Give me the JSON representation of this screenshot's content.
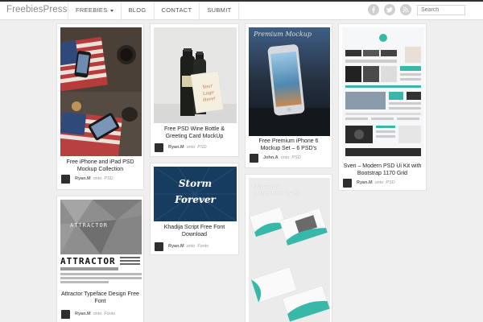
{
  "header": {
    "logo": "FreebiesPress",
    "nav": [
      {
        "label": "FREEBIES",
        "dropdown": true
      },
      {
        "label": "BLOG",
        "dropdown": false
      },
      {
        "label": "CONTACT",
        "dropdown": false
      },
      {
        "label": "SUBMIT",
        "dropdown": false
      }
    ],
    "social_icons": [
      "facebook-icon",
      "twitter-icon",
      "rss-icon"
    ],
    "search_placeholder": "Search"
  },
  "posts": [
    {
      "title": "Free iPhone and iPad PSD Mockup Collection",
      "author": "Ryan.M",
      "onto": "onto",
      "category": "PSD"
    },
    {
      "title": "Attractor Typeface Design Free Font",
      "author": "Ryan.M",
      "onto": "onto",
      "category": "Fonts",
      "image_text": "ATTRACTOR"
    },
    {
      "title": "Free PSD Wine Bottle & Greeting Card MockUp",
      "author": "Ryan.M",
      "onto": "onto",
      "category": "PSD",
      "image_text": "Your Logo Here!"
    },
    {
      "title": "Khadija Script Free Font Download",
      "author": "Ryan.M",
      "onto": "onto",
      "category": "Fonts",
      "image_text_1": "Storm",
      "image_text_2": "Forever"
    },
    {
      "title": "Free Premium iPhone 6 Mockup Set – 6 PSD's",
      "author": "John.A",
      "onto": "onto",
      "category": "PSD",
      "image_text": "Premium Mockup"
    },
    {
      "title": "",
      "image_text": "MODERN BUSINESS CARD"
    },
    {
      "title": "Sven – Modern PSD Ui Kit with Bootstrap 1170 Grid",
      "author": "Ryan.M",
      "onto": "onto",
      "category": "PSD"
    }
  ],
  "colors": {
    "header_line": "#2f2f2f",
    "accent_teal": "#37b8a8"
  }
}
